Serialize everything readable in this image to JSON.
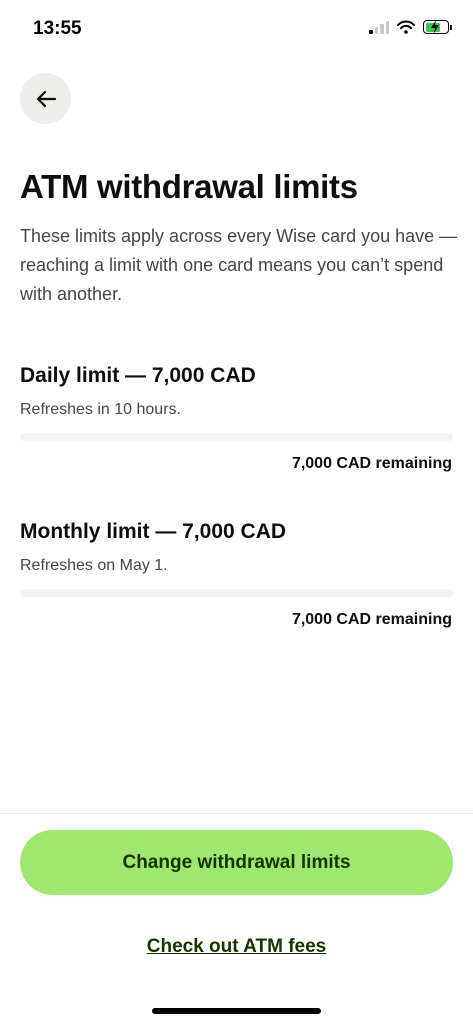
{
  "status_bar": {
    "time": "13:55"
  },
  "header": {
    "title": "ATM withdrawal limits",
    "description": "These limits apply across every Wise card you have — reaching a limit with one card means you can’t spend with another."
  },
  "limits": [
    {
      "title": "Daily limit — 7,000 CAD",
      "subtitle": "Refreshes in 10 hours.",
      "remaining": "7,000 CAD remaining",
      "used_fraction": 0
    },
    {
      "title": "Monthly limit — 7,000 CAD",
      "subtitle": "Refreshes on May 1.",
      "remaining": "7,000 CAD remaining",
      "used_fraction": 0
    }
  ],
  "actions": {
    "primary_label": "Change withdrawal limits",
    "link_label": "Check out ATM fees"
  },
  "colors": {
    "accent": "#9fe870",
    "accent_text": "#163300",
    "back_button_bg": "#ededec",
    "track_bg": "#f2f3f2"
  },
  "icons": {
    "back": "arrow-left-icon",
    "signal": "cellular-signal-icon",
    "wifi": "wifi-icon",
    "battery": "battery-charging-icon"
  }
}
